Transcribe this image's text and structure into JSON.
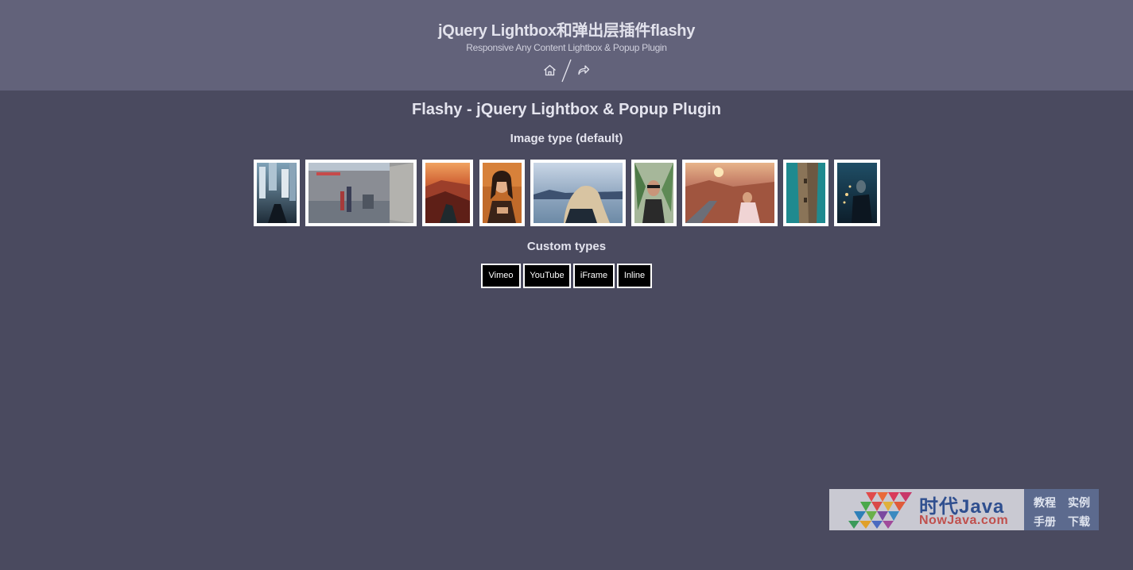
{
  "header": {
    "title": "jQuery Lightbox和弹出层插件flashy",
    "subtitle": "Responsive Any Content Lightbox & Popup Plugin",
    "icons": [
      "home-icon",
      "share-icon"
    ]
  },
  "main": {
    "title": "Flashy - jQuery Lightbox & Popup Plugin",
    "image_section_title": "Image type (default)",
    "custom_section_title": "Custom types",
    "custom_buttons": [
      "Vimeo",
      "YouTube",
      "iFrame",
      "Inline"
    ],
    "thumbnail_count": 9
  },
  "watermark": {
    "brand": "时代Java",
    "domain": "NowJava.com",
    "links": [
      "教程",
      "实例",
      "手册",
      "下载"
    ]
  },
  "colors": {
    "header_bg": "#62627a",
    "page_bg": "#4a4a5f",
    "button_bg": "#000000",
    "button_border": "#ffffff"
  }
}
